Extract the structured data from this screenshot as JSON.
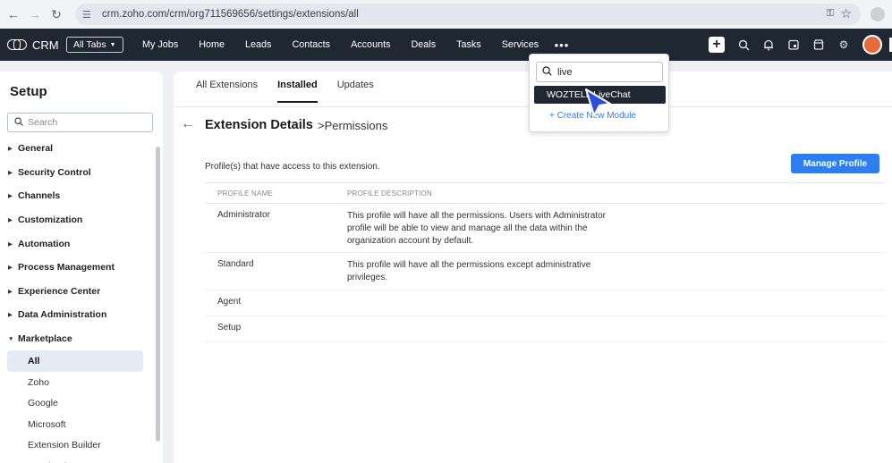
{
  "browser": {
    "url": "crm.zoho.com/crm/org711569656/settings/extensions/all"
  },
  "topnav": {
    "brand": "CRM",
    "all_tabs": "All Tabs",
    "items": [
      "My Jobs",
      "Home",
      "Leads",
      "Contacts",
      "Accounts",
      "Deals",
      "Tasks",
      "Services"
    ],
    "more": "•••"
  },
  "sidebar": {
    "title": "Setup",
    "search_placeholder": "Search",
    "sections": [
      "General",
      "Security Control",
      "Channels",
      "Customization",
      "Automation",
      "Process Management",
      "Experience Center",
      "Data Administration",
      "Marketplace"
    ],
    "marketplace_items": [
      "All",
      "Zoho",
      "Google",
      "Microsoft",
      "Extension Builder",
      "Facebook"
    ]
  },
  "main": {
    "tabs": [
      "All Extensions",
      "Installed",
      "Updates"
    ],
    "active_tab": "Installed",
    "title": "Extension Details",
    "subtitle": ">Permissions",
    "access_text": "Profile(s) that have access to this extension.",
    "manage_button": "Manage Profile",
    "table": {
      "headers": [
        "PROFILE NAME",
        "PROFILE DESCRIPTION"
      ],
      "rows": [
        {
          "name": "Administrator",
          "description": "This profile will have all the permissions. Users with Administrator profile will be able to view and manage all the data within the organization account by default."
        },
        {
          "name": "Standard",
          "description": "This profile will have all the permissions except administrative privileges."
        },
        {
          "name": "Agent",
          "description": ""
        },
        {
          "name": "Setup",
          "description": ""
        }
      ]
    }
  },
  "search_dropdown": {
    "query": "live",
    "result": "WOZTELL LiveChat",
    "create_link": "+ Create New Module"
  },
  "colors": {
    "nav_bg": "#1f2733",
    "accent": "#2d7ff0",
    "active_sidebar": "#e4ebf5"
  }
}
